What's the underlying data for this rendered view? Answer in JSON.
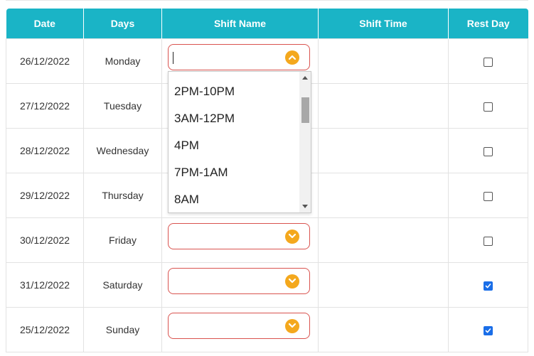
{
  "columns": [
    "Date",
    "Days",
    "Shift Name",
    "Shift Time",
    "Rest Day"
  ],
  "rows": [
    {
      "date": "26/12/2022",
      "day": "Monday",
      "rest": false,
      "focused": true
    },
    {
      "date": "27/12/2022",
      "day": "Tuesday",
      "rest": false
    },
    {
      "date": "28/12/2022",
      "day": "Wednesday",
      "rest": false
    },
    {
      "date": "29/12/2022",
      "day": "Thursday",
      "rest": false
    },
    {
      "date": "30/12/2022",
      "day": "Friday",
      "rest": false
    },
    {
      "date": "31/12/2022",
      "day": "Saturday",
      "rest": true
    },
    {
      "date": "25/12/2022",
      "day": "Sunday",
      "rest": true
    }
  ],
  "dropdown_options": [
    "2PM-10PM",
    "3AM-12PM",
    "4PM",
    "7PM-1AM",
    "8AM"
  ],
  "colors": {
    "header": "#1ab4c6",
    "chevron": "#f4a81d",
    "select_border": "#d9534f",
    "checkbox_checked": "#1a6ee8"
  }
}
